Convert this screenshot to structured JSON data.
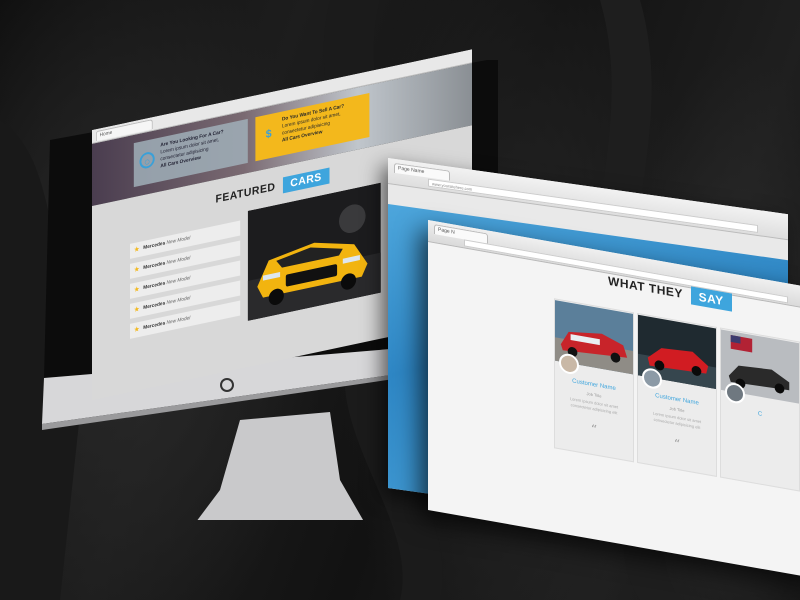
{
  "imac": {
    "browser_tab": "Home",
    "hero": {
      "buy_title": "Are You Looking For A Car?",
      "buy_text": "Lorem ipsum dolor sit amet, consectetur adipisicing",
      "buy_link": "All Cars Overview",
      "sell_title": "Do You Want To Sell A Car?",
      "sell_text": "Lorem ipsum dolor sit amet, consectetur adipisicing",
      "sell_link": "All Cars Overview",
      "sell_icon": "$"
    },
    "featured": {
      "heading_plain": "FEATURED",
      "heading_highlight": "CARS"
    },
    "models": [
      {
        "make": "Mercedes",
        "model": "New Model"
      },
      {
        "make": "Mercedes",
        "model": "New Model"
      },
      {
        "make": "Mercedes",
        "model": "New Model"
      },
      {
        "make": "Mercedes",
        "model": "New Model"
      },
      {
        "make": "Mercedes",
        "model": "New Model"
      }
    ]
  },
  "back_window": {
    "tab": "Page Name",
    "address": "www.yoursitehere.com"
  },
  "front_window": {
    "tab": "Page N",
    "heading_plain": "WHAT THEY",
    "heading_highlight": "SAY",
    "testimonials": [
      {
        "name": "Customer Name",
        "role": "Job Title",
        "text": "Lorem ipsum dolor sit amet consectetur adipisicing elit",
        "quote": "“"
      },
      {
        "name": "Customer Name",
        "role": "Job Title",
        "text": "Lorem ipsum dolor sit amet consectetur adipisicing elit",
        "quote": "“"
      },
      {
        "name": "C",
        "role": "",
        "text": "",
        "quote": ""
      }
    ]
  },
  "colors": {
    "accent_blue": "#3ea5dd",
    "accent_yellow": "#f3b81c",
    "background": "#141414"
  }
}
